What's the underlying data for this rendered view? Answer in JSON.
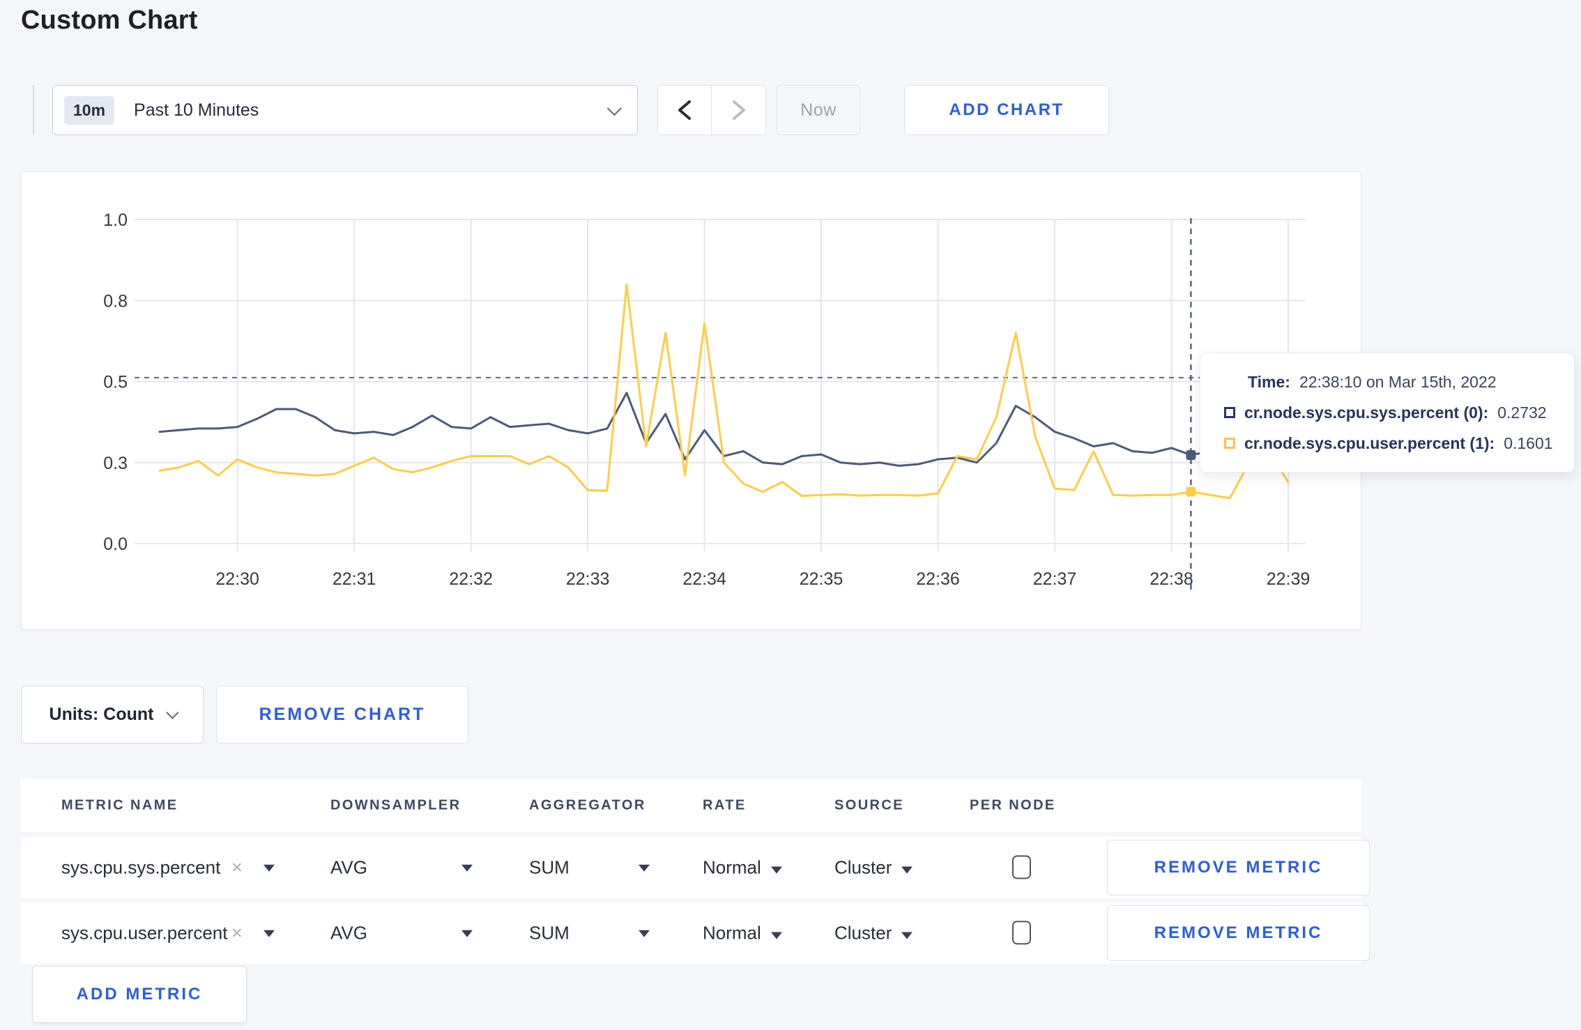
{
  "page": {
    "title": "Custom Chart",
    "background": "#f4f6f9",
    "accent_blue": "#2b5de2"
  },
  "toolbar": {
    "range_badge": "10m",
    "range_label": "Past 10 Minutes",
    "now_label": "Now",
    "add_chart_label": "ADD CHART",
    "prev_enabled": true,
    "next_enabled": false
  },
  "chart_data": {
    "type": "line",
    "title": "",
    "xlabel": "",
    "ylabel": "",
    "ylim": [
      0,
      1
    ],
    "grid": true,
    "x_start": "22:29:20",
    "x_step_seconds": 10,
    "x_tick_labels": [
      "22:30",
      "22:31",
      "22:32",
      "22:33",
      "22:34",
      "22:35",
      "22:36",
      "22:37",
      "22:38",
      "22:39"
    ],
    "y_tick_labels": [
      "0.0",
      "0.3",
      "0.5",
      "0.8",
      "1.0"
    ],
    "y_tick_values": [
      0,
      0.25,
      0.5,
      0.75,
      1.0
    ],
    "threshold_dashed_line": 0.512,
    "crosshair": {
      "time": "22:38:10",
      "index": 53
    },
    "grid_color": "#e7e7ea",
    "dash_color": "#55658a",
    "series": [
      {
        "name": "cr.node.sys.cpu.sys.percent (0)",
        "color": "#4b5b77",
        "values": [
          0.345,
          0.35,
          0.355,
          0.355,
          0.36,
          0.385,
          0.415,
          0.415,
          0.39,
          0.35,
          0.34,
          0.345,
          0.335,
          0.36,
          0.395,
          0.36,
          0.355,
          0.39,
          0.36,
          0.365,
          0.37,
          0.35,
          0.34,
          0.355,
          0.465,
          0.31,
          0.4,
          0.26,
          0.35,
          0.27,
          0.285,
          0.25,
          0.245,
          0.27,
          0.275,
          0.25,
          0.245,
          0.25,
          0.24,
          0.245,
          0.26,
          0.265,
          0.25,
          0.31,
          0.425,
          0.39,
          0.345,
          0.325,
          0.3,
          0.31,
          0.285,
          0.28,
          0.295,
          0.2732,
          0.285,
          0.28,
          0.29,
          0.3,
          0.295
        ]
      },
      {
        "name": "cr.node.sys.cpu.user.percent (1)",
        "color": "#ffcd43",
        "values": [
          0.225,
          0.235,
          0.255,
          0.21,
          0.26,
          0.235,
          0.22,
          0.215,
          0.21,
          0.215,
          0.24,
          0.265,
          0.23,
          0.22,
          0.235,
          0.255,
          0.27,
          0.27,
          0.27,
          0.245,
          0.27,
          0.235,
          0.165,
          0.163,
          0.8,
          0.3,
          0.65,
          0.21,
          0.68,
          0.25,
          0.185,
          0.16,
          0.19,
          0.147,
          0.15,
          0.152,
          0.148,
          0.15,
          0.15,
          0.148,
          0.155,
          0.27,
          0.26,
          0.39,
          0.65,
          0.33,
          0.17,
          0.165,
          0.285,
          0.15,
          0.148,
          0.15,
          0.15,
          0.1601,
          0.15,
          0.14,
          0.25,
          0.285,
          0.19
        ]
      }
    ]
  },
  "tooltip": {
    "time_label": "Time:",
    "time_value": "22:38:10 on Mar 15th, 2022",
    "rows": [
      {
        "label": "cr.node.sys.cpu.sys.percent (0):",
        "value": "0.2732",
        "swatch_color": "#24355e"
      },
      {
        "label": "cr.node.sys.cpu.user.percent (1):",
        "value": "0.1601",
        "swatch_color": "#fdc244"
      }
    ]
  },
  "units_bar": {
    "units_label": "Units: Count",
    "remove_chart_label": "REMOVE CHART"
  },
  "metrics_table": {
    "headers": [
      "METRIC NAME",
      "DOWNSAMPLER",
      "AGGREGATOR",
      "RATE",
      "SOURCE",
      "PER NODE"
    ],
    "rows": [
      {
        "metric": "sys.cpu.sys.percent",
        "downsampler": "AVG",
        "aggregator": "SUM",
        "rate": "Normal",
        "source": "Cluster",
        "per_node_checked": false,
        "remove_label": "REMOVE METRIC"
      },
      {
        "metric": "sys.cpu.user.percent",
        "downsampler": "AVG",
        "aggregator": "SUM",
        "rate": "Normal",
        "source": "Cluster",
        "per_node_checked": false,
        "remove_label": "REMOVE METRIC"
      }
    ],
    "add_metric_label": "ADD METRIC"
  }
}
